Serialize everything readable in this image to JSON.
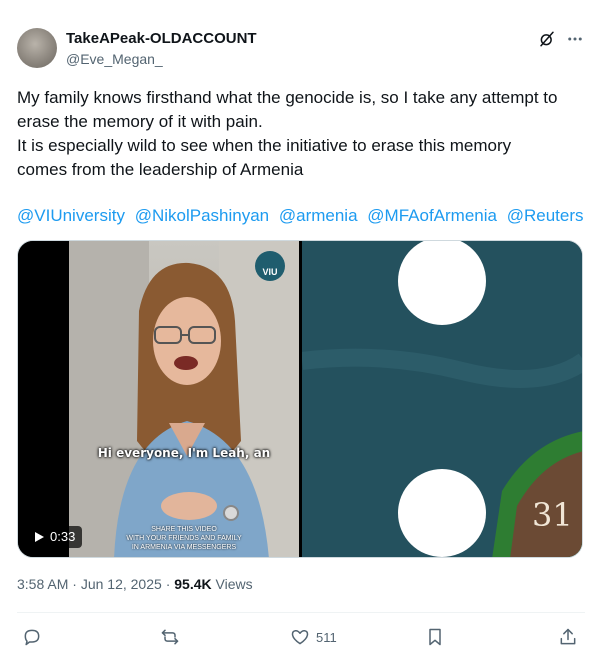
{
  "header": {
    "display_name": "TakeAPeak-OLDACCOUNT",
    "handle": "@Eve_Megan_",
    "icons": [
      "grok-icon",
      "more-icon"
    ]
  },
  "tweet": {
    "lines": [
      "My family knows firsthand what the genocide is, so I take any attempt to",
      "erase the memory of it with pain.",
      "It is especially wild to see when the initiative to erase this memory",
      "comes from the leadership of Armenia"
    ],
    "mentions": [
      "@VIUniversity",
      "@NikolPashinyan",
      "@armenia",
      "@MFAofArmenia",
      "@Reuters"
    ]
  },
  "media": {
    "video": {
      "logo_text": "VIU",
      "caption": "Hi everyone, I'm Leah, an",
      "share_lines": [
        "SHARE THIS VIDEO",
        "WITH YOUR FRIENDS AND FAMILY",
        "IN ARMENIA VIA MESSENGERS"
      ],
      "duration": "0:33"
    },
    "image": {
      "number_text": "31"
    }
  },
  "meta": {
    "time": "3:58 AM",
    "sep1": "·",
    "date": "Jun 12, 2025",
    "sep2": "·",
    "views_count": "95.4K",
    "views_label": "Views"
  },
  "actions": {
    "reply_icon": "reply-icon",
    "retweet_icon": "retweet-icon",
    "like_icon": "heart-icon",
    "like_count": "511",
    "bookmark_icon": "bookmark-icon",
    "share_icon": "share-icon"
  },
  "colors": {
    "text": "#0f1419",
    "secondary": "#536471",
    "link": "#1d9bf0",
    "border": "#cfd9de",
    "image_bg": "#24515e"
  }
}
